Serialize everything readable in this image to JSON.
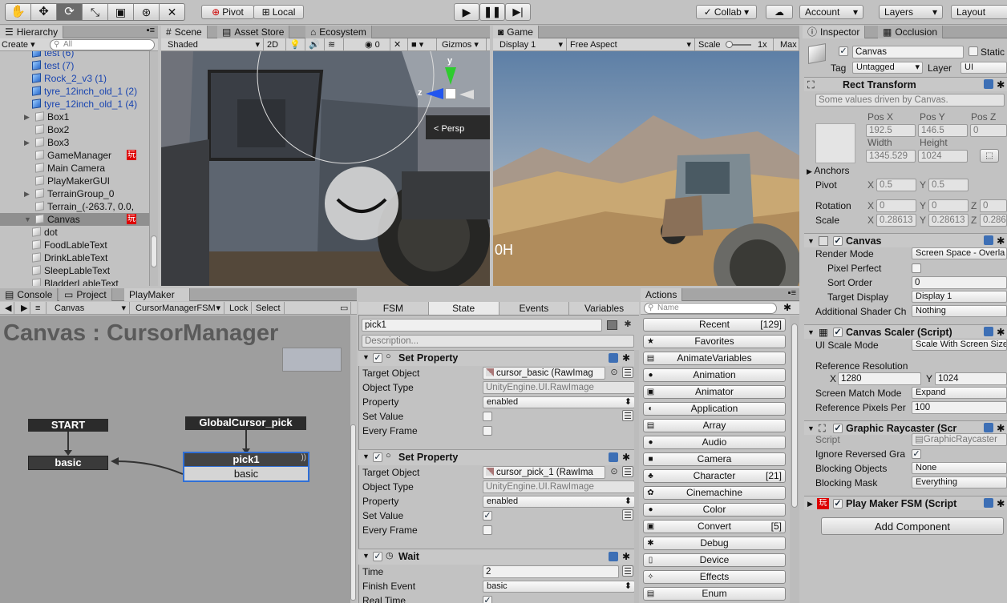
{
  "toolbar": {
    "tools": [
      "hand-icon",
      "move-icon",
      "rotate-icon",
      "scale-icon",
      "rect-icon",
      "transform-icon",
      "custom-tool-icon"
    ],
    "pivot": "Pivot",
    "local": "Local",
    "collab": "Collab ▾",
    "account": "Account",
    "layers": "Layers",
    "layout": "Layout"
  },
  "hierarchy": {
    "tab": "Hierarchy",
    "create": "Create ▾",
    "search_placeholder": "All",
    "items": [
      {
        "label": "test (6)",
        "indent": 1,
        "blue": true
      },
      {
        "label": "test (7)",
        "indent": 1,
        "blue": true
      },
      {
        "label": "Rock_2_v3 (1)",
        "indent": 1,
        "blue": true
      },
      {
        "label": "tyre_12inch_old_1 (2)",
        "indent": 1,
        "blue": true
      },
      {
        "label": "tyre_12inch_old_1 (4)",
        "indent": 1,
        "blue": true
      },
      {
        "label": "Box1",
        "indent": 0,
        "arrow": "▶"
      },
      {
        "label": "Box2",
        "indent": 0
      },
      {
        "label": "Box3",
        "indent": 0,
        "arrow": "▶"
      },
      {
        "label": "GameManager",
        "indent": 0,
        "badge": "玩"
      },
      {
        "label": "Main Camera",
        "indent": 0
      },
      {
        "label": "PlayMakerGUI",
        "indent": 0
      },
      {
        "label": "TerrainGroup_0",
        "indent": 0,
        "arrow": "▶"
      },
      {
        "label": "Terrain_(-263.7, 0.0,",
        "indent": 0
      },
      {
        "label": "Canvas",
        "indent": 0,
        "arrow": "▼",
        "badge": "玩",
        "selected": true
      },
      {
        "label": "dot",
        "indent": 1
      },
      {
        "label": "FoodLableText",
        "indent": 1
      },
      {
        "label": "DrinkLableText",
        "indent": 1
      },
      {
        "label": "SleepLableText",
        "indent": 1
      },
      {
        "label": "BladderLableText",
        "indent": 1
      }
    ]
  },
  "scene": {
    "tab": "Scene",
    "tab2": "Asset Store",
    "tab3": "Ecosystem",
    "shaded": "Shaded",
    "mode2d": "2D",
    "fx": "0",
    "gizmos": "Gizmos ▾",
    "persp": "< Persp",
    "axis_y": "y",
    "axis_z": "z"
  },
  "game": {
    "tab": "Game",
    "display": "Display 1",
    "aspect": "Free Aspect",
    "scale_label": "Scale",
    "scale_value": "1x",
    "max": "Max",
    "overlay_text": "0H"
  },
  "inspector": {
    "tab": "Inspector",
    "tab2": "Occlusion",
    "name": "Canvas",
    "static": "Static",
    "tag_label": "Tag",
    "tag": "Untagged",
    "layer_label": "Layer",
    "layer": "UI",
    "rect": {
      "title": "Rect Transform",
      "note": "Some values driven by Canvas.",
      "posx_l": "Pos X",
      "posy_l": "Pos Y",
      "posz_l": "Pos Z",
      "posx": "192.5",
      "posy": "146.5",
      "posz": "0",
      "w_l": "Width",
      "h_l": "Height",
      "w": "1345.529",
      "h": "1024",
      "anchors": "Anchors",
      "pivot": "Pivot",
      "pivot_x": "0.5",
      "pivot_y": "0.5",
      "rotation": "Rotation",
      "rot_x": "0",
      "rot_y": "0",
      "rot_z": "0",
      "scale": "Scale",
      "scale_x": "0.28613",
      "scale_y": "0.28613",
      "scale_z": "0.286",
      "x": "X",
      "y": "Y",
      "z": "Z"
    },
    "canvas": {
      "title": "Canvas",
      "render_mode_l": "Render Mode",
      "render_mode": "Screen Space - Overla",
      "pixel_perfect": "Pixel Perfect",
      "sort_order_l": "Sort Order",
      "sort_order": "0",
      "target_display_l": "Target Display",
      "target_display": "Display 1",
      "shader_l": "Additional Shader Ch",
      "shader": "Nothing"
    },
    "scaler": {
      "title": "Canvas Scaler (Script)",
      "mode_l": "UI Scale Mode",
      "mode": "Scale With Screen Size",
      "refres": "Reference Resolution",
      "x": "1280",
      "y": "1024",
      "match_l": "Screen Match Mode",
      "match": "Expand",
      "ppu_l": "Reference Pixels Per",
      "ppu": "100"
    },
    "raycaster": {
      "title": "Graphic Raycaster (Scr",
      "script_l": "Script",
      "script": "GraphicRaycaster",
      "ignore": "Ignore Reversed Gra",
      "block_l": "Blocking Objects",
      "block": "None",
      "mask_l": "Blocking Mask",
      "mask": "Everything"
    },
    "fsm": {
      "title": "Play Maker FSM (Script"
    },
    "add": "Add Component"
  },
  "bottom": {
    "tabs": [
      "Console",
      "Project",
      "PlayMaker"
    ],
    "go": "Canvas",
    "fsm": "CursorManagerFSM",
    "lock": "Lock",
    "select": "Select",
    "title": "Canvas : CursorManager"
  },
  "graph": {
    "start": "START",
    "basic": "basic",
    "global": "GlobalCursor_pick",
    "pick1": "pick1",
    "pick1_sub": "basic"
  },
  "state": {
    "tabs": [
      "FSM",
      "State",
      "Events",
      "Variables"
    ],
    "name": "pick1",
    "desc_placeholder": "Description...",
    "actions": [
      {
        "title": "Set Property",
        "rows": [
          {
            "l": "Target Object",
            "v": "cursor_basic (RawImag",
            "kind": "obj"
          },
          {
            "l": "Object Type",
            "v": "UnityEngine.UI.RawImage",
            "kind": "dis"
          },
          {
            "l": "Property",
            "v": "enabled",
            "kind": "drop"
          },
          {
            "l": "Set Value",
            "v": "",
            "kind": "chk",
            "checked": false
          },
          {
            "l": "Every Frame",
            "v": "",
            "kind": "chk2",
            "checked": false
          }
        ]
      },
      {
        "title": "Set Property",
        "rows": [
          {
            "l": "Target Object",
            "v": "cursor_pick_1 (RawIma",
            "kind": "obj"
          },
          {
            "l": "Object Type",
            "v": "UnityEngine.UI.RawImage",
            "kind": "dis"
          },
          {
            "l": "Property",
            "v": "enabled",
            "kind": "drop"
          },
          {
            "l": "Set Value",
            "v": "",
            "kind": "chk",
            "checked": true
          },
          {
            "l": "Every Frame",
            "v": "",
            "kind": "chk2",
            "checked": false
          }
        ]
      },
      {
        "title": "Wait",
        "rows": [
          {
            "l": "Time",
            "v": "2",
            "kind": "fld"
          },
          {
            "l": "Finish Event",
            "v": "basic",
            "kind": "drop"
          },
          {
            "l": "Real Time",
            "v": "",
            "kind": "chk2",
            "checked": true
          }
        ]
      }
    ]
  },
  "actions": {
    "tab": "Actions",
    "search_placeholder": "Name",
    "items": [
      {
        "label": "Recent",
        "count": "[129]",
        "icon": ""
      },
      {
        "label": "Favorites",
        "count": "",
        "icon": "★"
      },
      {
        "label": "AnimateVariables",
        "count": "",
        "icon": "▤"
      },
      {
        "label": "Animation",
        "count": "",
        "icon": "●"
      },
      {
        "label": "Animator",
        "count": "",
        "icon": "▣"
      },
      {
        "label": "Application",
        "count": "",
        "icon": "◐"
      },
      {
        "label": "Array",
        "count": "",
        "icon": "▤"
      },
      {
        "label": "Audio",
        "count": "",
        "icon": "●"
      },
      {
        "label": "Camera",
        "count": "",
        "icon": "■"
      },
      {
        "label": "Character",
        "count": "[21]",
        "icon": "♣"
      },
      {
        "label": "Cinemachine",
        "count": "",
        "icon": "✿"
      },
      {
        "label": "Color",
        "count": "",
        "icon": "●"
      },
      {
        "label": "Convert",
        "count": "[5]",
        "icon": "▣"
      },
      {
        "label": "Debug",
        "count": "",
        "icon": "✱"
      },
      {
        "label": "Device",
        "count": "",
        "icon": "▯"
      },
      {
        "label": "Effects",
        "count": "",
        "icon": "✧"
      },
      {
        "label": "Enum",
        "count": "",
        "icon": "▤"
      }
    ]
  }
}
